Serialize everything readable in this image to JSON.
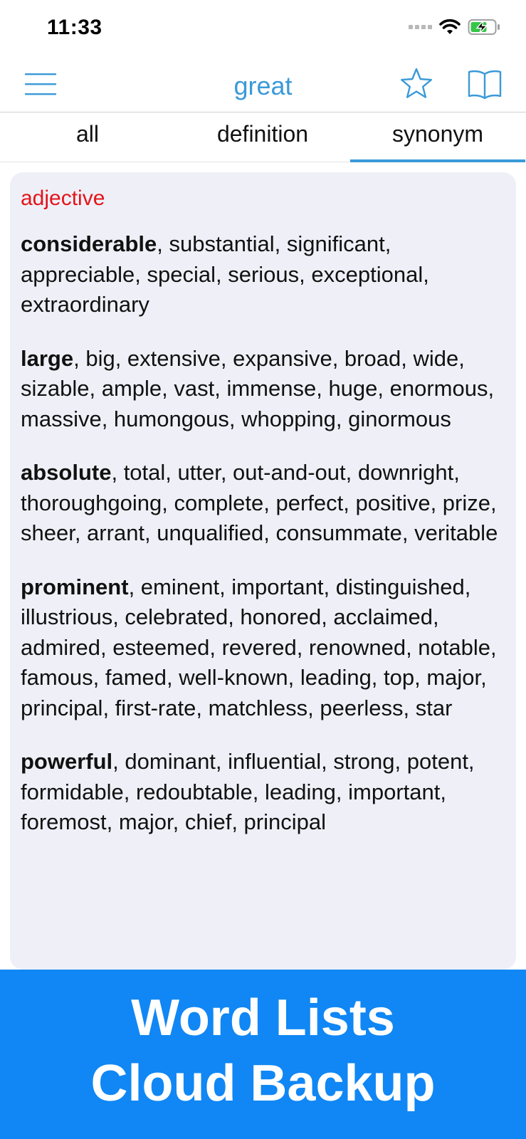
{
  "status_bar": {
    "time": "11:33"
  },
  "nav": {
    "title": "great"
  },
  "tabs": [
    {
      "label": "all"
    },
    {
      "label": "definition"
    },
    {
      "label": "synonym",
      "active": true
    }
  ],
  "part_of_speech": "adjective",
  "synonym_groups": [
    {
      "head": "considerable",
      "rest": ", substantial, significant, appreciable, special, serious, exceptional, extraordinary"
    },
    {
      "head": "large",
      "rest": ", big, extensive, expansive, broad, wide, sizable, ample, vast, immense, huge, enormous, massive, humongous, whopping, ginormous"
    },
    {
      "head": "absolute",
      "rest": ", total, utter, out-and-out, downright, thoroughgoing, complete, perfect, positive, prize, sheer, arrant, unqualified, consummate, veritable"
    },
    {
      "head": "prominent",
      "rest": ", eminent, important, distinguished, illustrious, celebrated, honored, acclaimed, admired, esteemed, revered, renowned, notable, famous, famed, well-known, leading, top, major, principal, first-rate, matchless, peerless, star"
    },
    {
      "head": "powerful",
      "rest": ", dominant, influential, strong, potent, formidable, redoubtable, leading, important, foremost, major, chief, principal"
    }
  ],
  "promo": {
    "line1": "Word Lists",
    "line2": "Cloud Backup"
  },
  "colors": {
    "accent": "#3a9ad8",
    "pos_label": "#e4141b",
    "banner": "#1087f4",
    "card": "#eff0f7"
  },
  "icons": [
    "signal-dots-icon",
    "wifi-icon",
    "battery-charging-icon",
    "hamburger-menu-icon",
    "star-icon",
    "book-icon"
  ]
}
